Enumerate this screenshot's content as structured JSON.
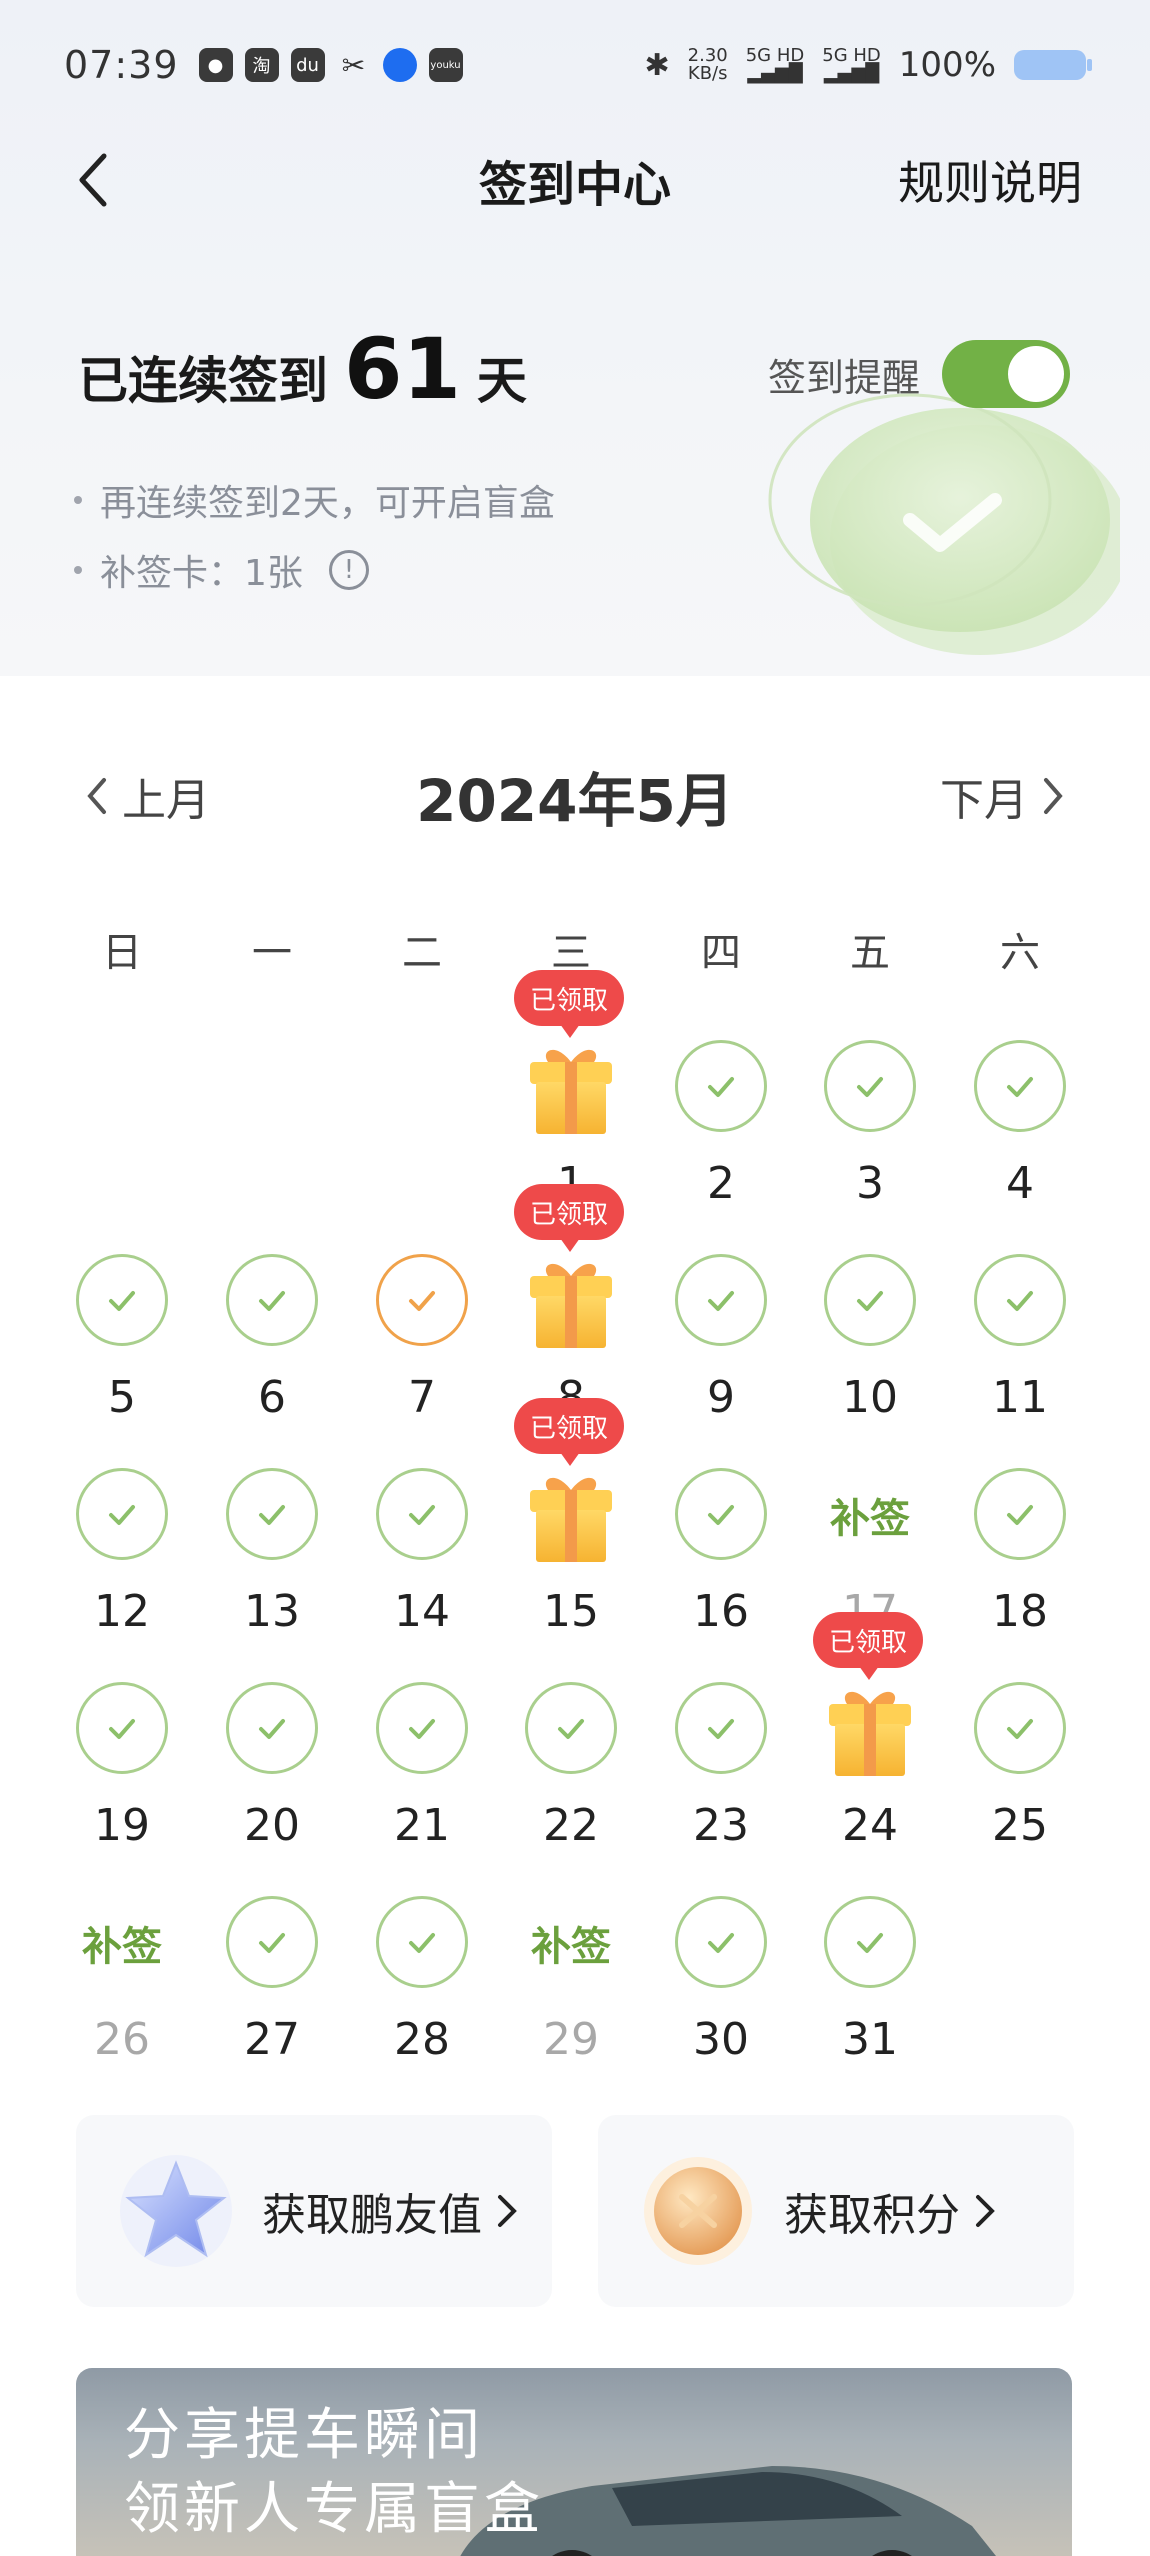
{
  "status_bar": {
    "time": "07:39",
    "apps": [
      "wechat-icon",
      "taobao-icon",
      "du-icon",
      "scissor-icon",
      "browser-icon",
      "youku-icon"
    ],
    "app_labels": [
      "",
      "淘",
      "du",
      "✂",
      "",
      "youku"
    ],
    "net_speed": "2.30",
    "net_unit": "KB/s",
    "sim1": "5G HD",
    "sim2": "5G HD",
    "battery": "100%"
  },
  "nav": {
    "title": "签到中心",
    "rules_label": "规则说明"
  },
  "streak": {
    "label": "已连续签到",
    "days": "61",
    "unit": "天",
    "reminder_label": "签到提醒",
    "reminder_on": true
  },
  "hints": {
    "blind_box": "再连续签到2天，可开启盲盒",
    "makeup_cards": "补签卡：1张"
  },
  "calendar": {
    "prev_label": "上月",
    "next_label": "下月",
    "month_title": "2024年5月",
    "weekdays": [
      "日",
      "一",
      "二",
      "三",
      "四",
      "五",
      "六"
    ],
    "claimed_label": "已领取",
    "makeup_label": "补签",
    "days": [
      {
        "day": "1",
        "status": "gift"
      },
      {
        "day": "2",
        "status": "checked"
      },
      {
        "day": "3",
        "status": "checked"
      },
      {
        "day": "4",
        "status": "checked"
      },
      {
        "day": "5",
        "status": "checked"
      },
      {
        "day": "6",
        "status": "checked"
      },
      {
        "day": "7",
        "status": "today"
      },
      {
        "day": "8",
        "status": "gift"
      },
      {
        "day": "9",
        "status": "checked"
      },
      {
        "day": "10",
        "status": "checked"
      },
      {
        "day": "11",
        "status": "checked"
      },
      {
        "day": "12",
        "status": "checked"
      },
      {
        "day": "13",
        "status": "checked"
      },
      {
        "day": "14",
        "status": "checked"
      },
      {
        "day": "15",
        "status": "gift"
      },
      {
        "day": "16",
        "status": "checked"
      },
      {
        "day": "17",
        "status": "makeup"
      },
      {
        "day": "18",
        "status": "checked"
      },
      {
        "day": "19",
        "status": "checked"
      },
      {
        "day": "20",
        "status": "checked"
      },
      {
        "day": "21",
        "status": "checked"
      },
      {
        "day": "22",
        "status": "checked"
      },
      {
        "day": "23",
        "status": "checked"
      },
      {
        "day": "24",
        "status": "gift"
      },
      {
        "day": "25",
        "status": "checked"
      },
      {
        "day": "26",
        "status": "makeup"
      },
      {
        "day": "27",
        "status": "checked"
      },
      {
        "day": "28",
        "status": "checked"
      },
      {
        "day": "29",
        "status": "makeup"
      },
      {
        "day": "30",
        "status": "checked"
      },
      {
        "day": "31",
        "status": "checked"
      }
    ]
  },
  "promos": {
    "friend_value": "获取鹏友值",
    "points": "获取积分"
  },
  "banner": {
    "line1": "分享提车瞬间",
    "line2": "领新人专属盲盒"
  },
  "colors": {
    "accent_green": "#72b146",
    "check_green": "#8cc06a",
    "today_orange": "#f0a24a",
    "claimed_red": "#ee4a4a"
  }
}
